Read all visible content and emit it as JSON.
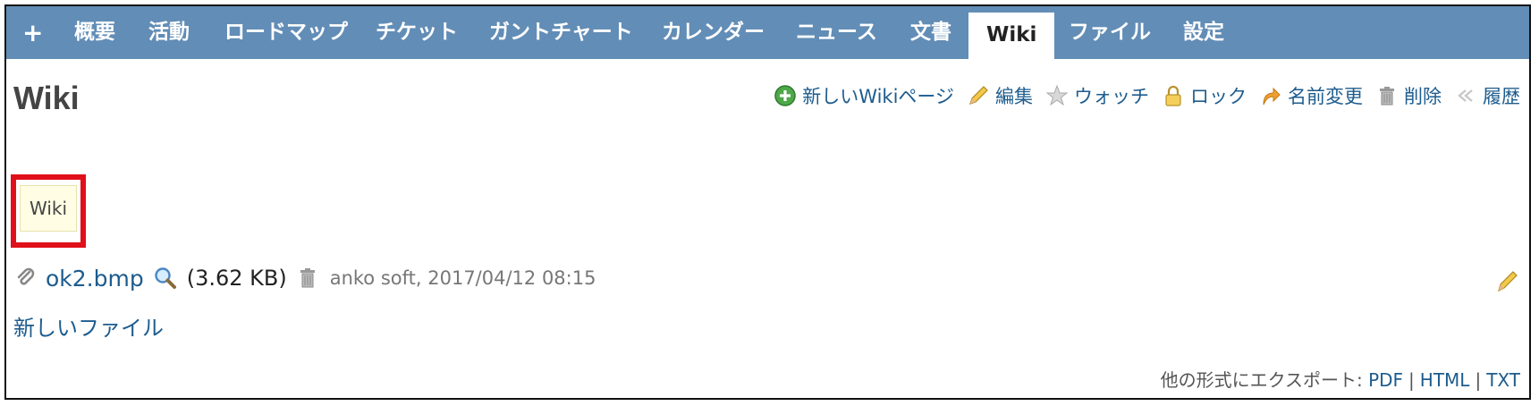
{
  "tabs": [
    {
      "label": "+"
    },
    {
      "label": "概要"
    },
    {
      "label": "活動"
    },
    {
      "label": "ロードマップ"
    },
    {
      "label": "チケット"
    },
    {
      "label": "ガントチャート"
    },
    {
      "label": "カレンダー"
    },
    {
      "label": "ニュース"
    },
    {
      "label": "文書"
    },
    {
      "label": "Wiki",
      "active": true
    },
    {
      "label": "ファイル"
    },
    {
      "label": "設定"
    }
  ],
  "page": {
    "title": "Wiki"
  },
  "actions": {
    "new_page": "新しいWikiページ",
    "edit": "編集",
    "watch": "ウォッチ",
    "lock": "ロック",
    "rename": "名前変更",
    "delete": "削除",
    "history": "履歴"
  },
  "content": {
    "wiki_text": "Wiki"
  },
  "attachment": {
    "filename": "ok2.bmp",
    "size": "(3.62 KB)",
    "author_date": "anko soft, 2017/04/12 08:15"
  },
  "new_file_label": "新しいファイル",
  "export": {
    "prefix": "他の形式にエクスポート:",
    "pdf": "PDF",
    "html": "HTML",
    "txt": "TXT",
    "separator": "|"
  },
  "colors": {
    "tab_bar": "#628db6",
    "link": "#1d5c8e",
    "highlight": "#e0101a",
    "wiki_box_bg": "#fffde3"
  }
}
